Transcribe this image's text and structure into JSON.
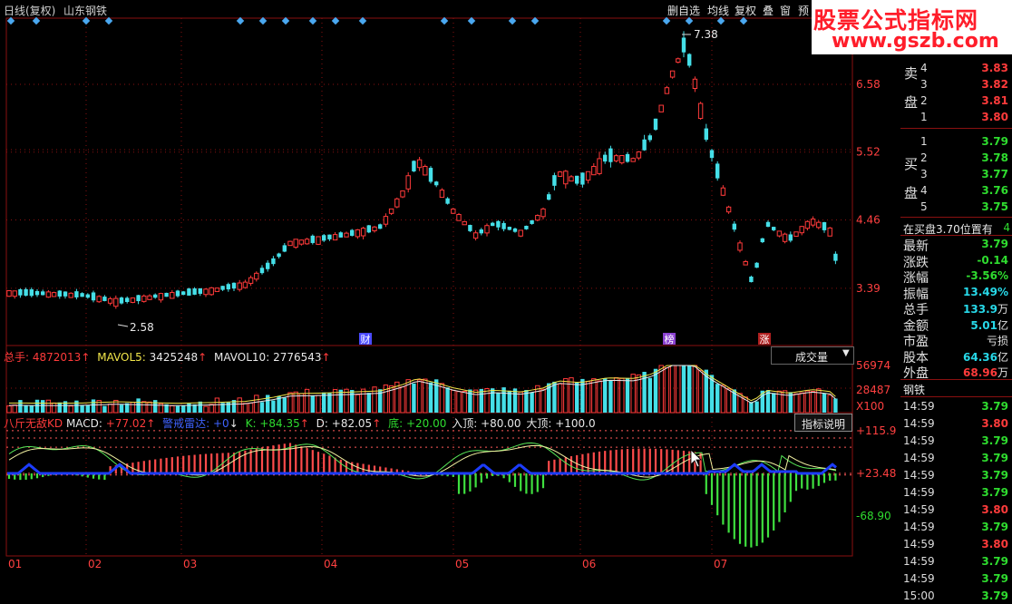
{
  "window": {
    "title": "日线(复权)",
    "stock_name": "山东钢铁",
    "menu": [
      "删自选",
      "均线",
      "复权",
      "叠",
      "窗",
      "预"
    ]
  },
  "watermark": {
    "line1": "股票公式指标网",
    "line2": "www.gszb.com"
  },
  "price_chart": {
    "y_ticks": [
      "6.58",
      "5.52",
      "4.46",
      "3.39"
    ],
    "y_values": [
      6.58,
      5.52,
      4.46,
      3.39
    ],
    "high_label": "7.38",
    "low_label": "2.58",
    "event_tags": [
      "财",
      "榜",
      "涨"
    ],
    "colors": {
      "up": "#ff3a3a",
      "down": "#45dfe8",
      "grid": "#8a1010",
      "axis": "#c02020"
    }
  },
  "volume_panel": {
    "total_label": "总手:",
    "total_value": "4872013",
    "mavol5_label": "MAVOL5:",
    "mavol5_value": "3425248",
    "mavol10_label": "MAVOL10:",
    "mavol10_value": "2776543",
    "dropdown": "成交量",
    "ticks": [
      "56974",
      "28487",
      "X100"
    ]
  },
  "indicator_panel": {
    "name": "八斤无敌KD",
    "macd_label": "MACD:",
    "macd_value": "+77.02",
    "radar_label": "警戒雷达:",
    "radar_value": "+0",
    "k_label": "K:",
    "k_value": "+84.35",
    "d_label": "D:",
    "d_value": "+82.05",
    "di_label": "底:",
    "di_value": "+20.00",
    "ding_label": "入顶:",
    "ding_value": "+80.00",
    "big_label": "大顶:",
    "big_value": "+100.0",
    "help_button": "指标说明",
    "ticks": [
      "+115.9",
      "+23.48",
      "-68.90"
    ]
  },
  "x_axis": [
    "01",
    "02",
    "03",
    "04",
    "05",
    "06",
    "07"
  ],
  "order_book": {
    "sell_label": [
      "卖",
      "盘"
    ],
    "buy_label": [
      "买",
      "盘"
    ],
    "sell": [
      {
        "level": "4",
        "price": "3.83"
      },
      {
        "level": "3",
        "price": "3.82"
      },
      {
        "level": "2",
        "price": "3.81"
      },
      {
        "level": "1",
        "price": "3.80"
      }
    ],
    "buy": [
      {
        "level": "1",
        "price": "3.79"
      },
      {
        "level": "2",
        "price": "3.78"
      },
      {
        "level": "3",
        "price": "3.77"
      },
      {
        "level": "4",
        "price": "3.76"
      },
      {
        "level": "5",
        "price": "3.75"
      }
    ],
    "note": "在买盘3.70位置有",
    "note_tail": "4"
  },
  "quote": [
    {
      "label": "最新",
      "value": "3.79",
      "unit": ""
    },
    {
      "label": "涨跌",
      "value": "-0.14",
      "unit": ""
    },
    {
      "label": "涨幅",
      "value": "-3.56%",
      "unit": ""
    },
    {
      "label": "振幅",
      "value": "13.49%",
      "unit": ""
    },
    {
      "label": "总手",
      "value": "133.9",
      "unit": "万"
    },
    {
      "label": "金额",
      "value": "5.01",
      "unit": "亿"
    },
    {
      "label": "市盈",
      "value": "",
      "unit": "亏损"
    },
    {
      "label": "股本",
      "value": "64.36",
      "unit": "亿"
    },
    {
      "label": "外盘",
      "value": "68.96",
      "unit": "万"
    }
  ],
  "ticks_header": "钢铁",
  "trades": [
    {
      "time": "14:59",
      "price": "3.79"
    },
    {
      "time": "14:59",
      "price": "3.80"
    },
    {
      "time": "14:59",
      "price": "3.79"
    },
    {
      "time": "14:59",
      "price": "3.79"
    },
    {
      "time": "14:59",
      "price": "3.79"
    },
    {
      "time": "14:59",
      "price": "3.79"
    },
    {
      "time": "14:59",
      "price": "3.80"
    },
    {
      "time": "14:59",
      "price": "3.79"
    },
    {
      "time": "14:59",
      "price": "3.80"
    },
    {
      "time": "14:59",
      "price": "3.79"
    },
    {
      "time": "14:59",
      "price": "3.79"
    },
    {
      "time": "15:00",
      "price": "3.79"
    }
  ]
}
